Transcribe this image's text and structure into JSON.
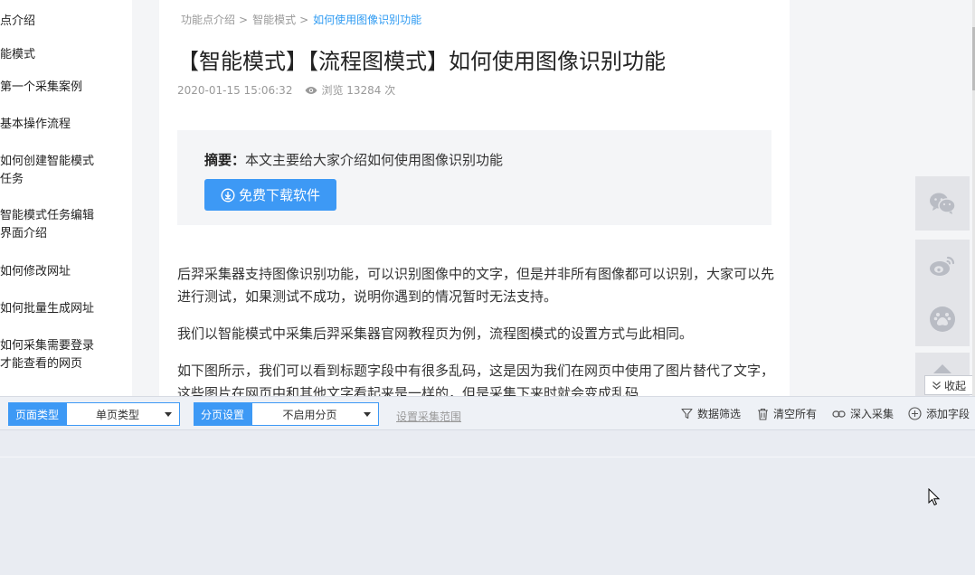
{
  "sidebar": {
    "items": [
      {
        "label": "点介绍"
      },
      {
        "label": "能模式"
      },
      {
        "label": "第一个采集案例"
      },
      {
        "label": "基本操作流程"
      },
      {
        "label": "如何创建智能模式",
        "label2": "任务"
      },
      {
        "label": "智能模式任务编辑",
        "label2": "界面介绍"
      },
      {
        "label": "如何修改网址"
      },
      {
        "label": "如何批量生成网址"
      },
      {
        "label": "如何采集需要登录",
        "label2": "才能查看的网页"
      }
    ]
  },
  "breadcrumb": {
    "items": [
      "功能点介绍",
      "智能模式"
    ],
    "separator": ">",
    "current": "如何使用图像识别功能"
  },
  "article": {
    "title": "【智能模式】【流程图模式】如何使用图像识别功能",
    "date": "2020-01-15 15:06:32",
    "views": "浏览 13284 次",
    "summary_label": "摘要：",
    "summary_text": "本文主要给大家介绍如何使用图像识别功能",
    "download_label": "免费下载软件",
    "paragraphs": [
      "后羿采集器支持图像识别功能，可以识别图像中的文字，但是并非所有图像都可以识别，大家可以先进行测试，如果测试不成功，说明你遇到的情况暂时无法支持。",
      "我们以智能模式中采集后羿采集器官网教程页为例，流程图模式的设置方式与此相同。",
      "如下图所示，我们可以看到标题字段中有很多乱码，这是因为我们在网页中使用了图片替代了文字，这些图片在网页中和其他文字看起来是一样的，但是采集下来时就会变成乱码"
    ]
  },
  "share": {
    "icons": [
      "wechat-icon",
      "weibo-icon",
      "baidu-icon",
      "top-icon"
    ]
  },
  "collapse_label": "收起",
  "toolbar": {
    "page_type_label": "页面类型",
    "page_type_value": "单页类型",
    "paging_label": "分页设置",
    "paging_value": "不启用分页",
    "range_link": "设置采集范围",
    "filter_label": "数据筛选",
    "clear_label": "清空所有",
    "deep_label": "深入采集",
    "add_field_label": "添加字段"
  },
  "colors": {
    "accent": "#3d99f5",
    "breadcrumb_current": "#2f9bf2",
    "share_bg": "#e3e4e8"
  }
}
